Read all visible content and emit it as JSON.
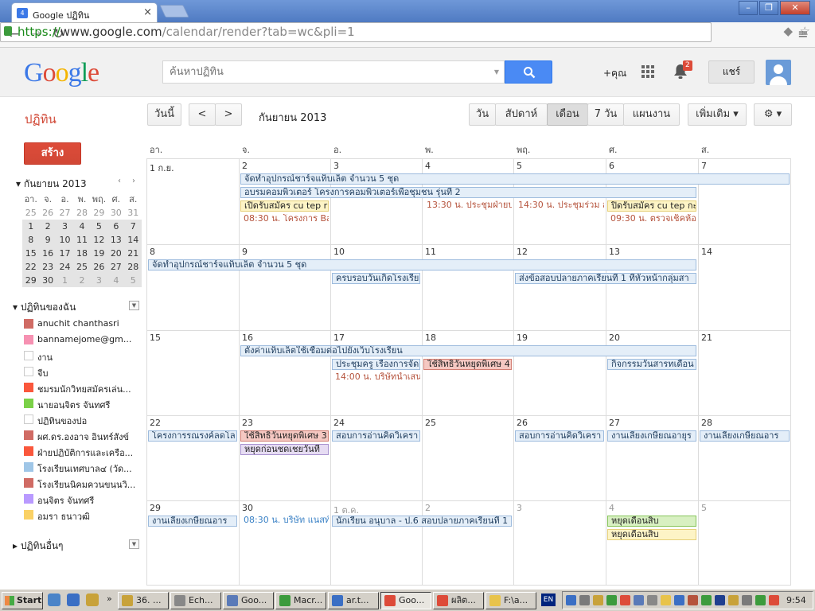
{
  "browser": {
    "tab_title": "Google ปฏิทิน",
    "tab_favicon": "4",
    "url_scheme": "https://",
    "url_host": "www.google.com",
    "url_path": "/calendar/render?tab=wc&pli=1"
  },
  "header": {
    "logo": "Google",
    "search_placeholder": "ค้นหาปฏิทิน",
    "plus_user": "+คุณ",
    "notification_count": "2",
    "share_label": "แชร์"
  },
  "toolbar": {
    "app_name": "ปฏิทิน",
    "today": "วันนี้",
    "prev": "<",
    "next": ">",
    "date_range": "กันยายน 2013",
    "views": [
      "วัน",
      "สัปดาห์",
      "เดือน",
      "7 วัน",
      "แผนงาน"
    ],
    "more": "เพิ่มเติม ▾",
    "settings": "⚙ ▾"
  },
  "sidebar": {
    "create": "สร้าง",
    "mini_title": "▾ กันยายน 2013",
    "mini_prev": "‹",
    "mini_next": "›",
    "mini_days": [
      "อา.",
      "จ.",
      "อ.",
      "พ.",
      "พฤ.",
      "ศ.",
      "ส."
    ],
    "mini_weeks": [
      [
        "25",
        "26",
        "27",
        "28",
        "29",
        "30",
        "31"
      ],
      [
        "1",
        "2",
        "3",
        "4",
        "5",
        "6",
        "7"
      ],
      [
        "8",
        "9",
        "10",
        "11",
        "12",
        "13",
        "14"
      ],
      [
        "15",
        "16",
        "17",
        "18",
        "19",
        "20",
        "21"
      ],
      [
        "22",
        "23",
        "24",
        "25",
        "26",
        "27",
        "28"
      ],
      [
        "29",
        "30",
        "1",
        "2",
        "3",
        "4",
        "5"
      ]
    ],
    "my_calendars_title": "▾ ปฏิทินของฉัน",
    "my_calendars": [
      {
        "name": "anuchit chanthasri",
        "color": "#d06b64"
      },
      {
        "name": "bannamejome@gm...",
        "color": "#f691b2"
      },
      {
        "name": "งาน",
        "color": "#ffffff"
      },
      {
        "name": "จีบ",
        "color": "#ffffff"
      },
      {
        "name": "ชมรมนักวิทยุสมัครเล่น...",
        "color": "#fa573c"
      },
      {
        "name": "นายอนุจิตร จันทศรี",
        "color": "#7bd148"
      },
      {
        "name": "ปฏิทินของปอ",
        "color": "#ffffff"
      },
      {
        "name": "ผศ.ดร.องอาจ อินทร์สังข์",
        "color": "#d06b64"
      },
      {
        "name": "ฝ่ายปฏิบัติการและเครือ...",
        "color": "#fa573c"
      },
      {
        "name": "โรงเรียนเทศบาล๔ (วัด...",
        "color": "#9fc6e7"
      },
      {
        "name": "โรงเรียนนิคมควนขนุนวิ...",
        "color": "#d06b64"
      },
      {
        "name": "อนุจิตร จันทศรี",
        "color": "#b99aff"
      },
      {
        "name": "อมรา ธนาวุฒิ",
        "color": "#fad165"
      }
    ],
    "other_calendars_title": "▸ ปฏิทินอื่นๆ"
  },
  "calendar": {
    "weekdays": [
      "อา.",
      "จ.",
      "อ.",
      "พ.",
      "พฤ.",
      "ศ.",
      "ส."
    ],
    "weeks": [
      [
        "1 ก.ย.",
        "2",
        "3",
        "4",
        "5",
        "6",
        "7"
      ],
      [
        "8",
        "9",
        "10",
        "11",
        "12",
        "13",
        "14"
      ],
      [
        "15",
        "16",
        "17",
        "18",
        "19",
        "20",
        "21"
      ],
      [
        "22",
        "23",
        "24",
        "25",
        "26",
        "27",
        "28"
      ],
      [
        "29",
        "30",
        "1 ต.ค.",
        "2",
        "3",
        "4",
        "5"
      ]
    ],
    "events": [
      {
        "text": "จัดทำอุปกรณ์ชาร์จแท็บเล็ต จำนวน 5 ชุด",
        "week": 0,
        "col": 1,
        "span": 6,
        "row": 0,
        "style": "blue"
      },
      {
        "text": "อบรมคอมพิวเตอร์ โครงการคอมพิวเตอร์เพื่อชุมชน รุ่นที่ 2",
        "week": 0,
        "col": 1,
        "span": 5,
        "row": 1,
        "style": "blue"
      },
      {
        "text": "เปิดรับสมัคร cu tep r",
        "week": 0,
        "col": 1,
        "span": 1,
        "row": 2,
        "style": "yel"
      },
      {
        "text": "08:30 น. โครงการ Ba",
        "week": 0,
        "col": 1,
        "span": 1,
        "row": 3,
        "style": "txtr"
      },
      {
        "text": "13:30 น. ประชุมฝ่ายป",
        "week": 0,
        "col": 3,
        "span": 1,
        "row": 2,
        "style": "txtr"
      },
      {
        "text": "14:30 น. ประชุมร่วม ส",
        "week": 0,
        "col": 4,
        "span": 1,
        "row": 2,
        "style": "txtr"
      },
      {
        "text": "ปิดรับสมัคร cu tep กะ",
        "week": 0,
        "col": 5,
        "span": 1,
        "row": 2,
        "style": "yel"
      },
      {
        "text": "09:30 น. ตรวจเช็คห้อ",
        "week": 0,
        "col": 5,
        "span": 1,
        "row": 3,
        "style": "txtr"
      },
      {
        "text": "จัดทำอุปกรณ์ชาร์จแท็บเล็ต จำนวน 5 ชุด",
        "week": 1,
        "col": 0,
        "span": 6,
        "row": 0,
        "style": "blue"
      },
      {
        "text": "ครบรอบวันเกิดโรงเรีย",
        "week": 1,
        "col": 2,
        "span": 1,
        "row": 1,
        "style": "blue"
      },
      {
        "text": "ส่งข้อสอบปลายภาคเรียนที่ 1 ที่หัวหน้ากลุ่มสา",
        "week": 1,
        "col": 4,
        "span": 2,
        "row": 1,
        "style": "blue"
      },
      {
        "text": "ตั้งค่าแท็บเล็ตใช้เชื่อมต่อไปยังเว็บโรงเรียน",
        "week": 2,
        "col": 1,
        "span": 5,
        "row": 0,
        "style": "blue"
      },
      {
        "text": "ประชุมครู เรื่องการจัด",
        "week": 2,
        "col": 2,
        "span": 1,
        "row": 1,
        "style": "blue"
      },
      {
        "text": "14:00 น. บริษัทนำเสน",
        "week": 2,
        "col": 2,
        "span": 1,
        "row": 2,
        "style": "txtr"
      },
      {
        "text": "ใช้สิทธิวันหยุดพิเศษ 4",
        "week": 2,
        "col": 3,
        "span": 1,
        "row": 1,
        "style": "red"
      },
      {
        "text": "กิจกรรมวันสารทเดือน",
        "week": 2,
        "col": 5,
        "span": 1,
        "row": 1,
        "style": "blue"
      },
      {
        "text": "โครงการรณรงค์ลดโล",
        "week": 3,
        "col": 0,
        "span": 1,
        "row": 0,
        "style": "blue"
      },
      {
        "text": "ใช้สิทธิวันหยุดพิเศษ 3",
        "week": 3,
        "col": 1,
        "span": 1,
        "row": 0,
        "style": "red"
      },
      {
        "text": "หยุดก่อนชดเชยวันที่",
        "week": 3,
        "col": 1,
        "span": 1,
        "row": 1,
        "style": "pur"
      },
      {
        "text": "สอบการอ่านคิดวิเครา",
        "week": 3,
        "col": 2,
        "span": 1,
        "row": 0,
        "style": "blue"
      },
      {
        "text": "สอบการอ่านคิดวิเครา",
        "week": 3,
        "col": 4,
        "span": 1,
        "row": 0,
        "style": "blue"
      },
      {
        "text": "งานเลี้ยงเกษียณอายุร",
        "week": 3,
        "col": 5,
        "span": 1,
        "row": 0,
        "style": "blue"
      },
      {
        "text": "งานเลี้ยงเกษียณอาร",
        "week": 3,
        "col": 6,
        "span": 1,
        "row": 0,
        "style": "blue"
      },
      {
        "text": "งานเลี้ยงเกษียณอาร",
        "week": 4,
        "col": 0,
        "span": 1,
        "row": 0,
        "style": "blue"
      },
      {
        "text": "08:30 น. บริษัท แนสท์",
        "week": 4,
        "col": 1,
        "span": 1,
        "row": 0,
        "style": "txtb"
      },
      {
        "text": "นักเรียน อนุบาล - ป.6 สอบปลายภาคเรียนที่ 1",
        "week": 4,
        "col": 2,
        "span": 2,
        "row": 0,
        "style": "blue"
      },
      {
        "text": "หยุดเดือนสิบ",
        "week": 4,
        "col": 5,
        "span": 1,
        "row": 0,
        "style": "grn"
      },
      {
        "text": "หยุดเดือนสิบ",
        "week": 4,
        "col": 5,
        "span": 1,
        "row": 1,
        "style": "yel"
      }
    ]
  },
  "taskbar": {
    "start": "Start",
    "items": [
      {
        "label": "36. ...",
        "color": "#c8a23a"
      },
      {
        "label": "Ech...",
        "color": "#888888"
      },
      {
        "label": "Goo...",
        "color": "#5a7ab8"
      },
      {
        "label": "Macr...",
        "color": "#3c9b3c"
      },
      {
        "label": "ar.t...",
        "color": "#3b6fc4"
      },
      {
        "label": "Goo...",
        "color": "#dd4b39"
      },
      {
        "label": "ผลิต...",
        "color": "#dd4b39"
      },
      {
        "label": "F:\\a...",
        "color": "#e8c34a"
      }
    ],
    "lang": "EN",
    "clock": "9:54"
  }
}
